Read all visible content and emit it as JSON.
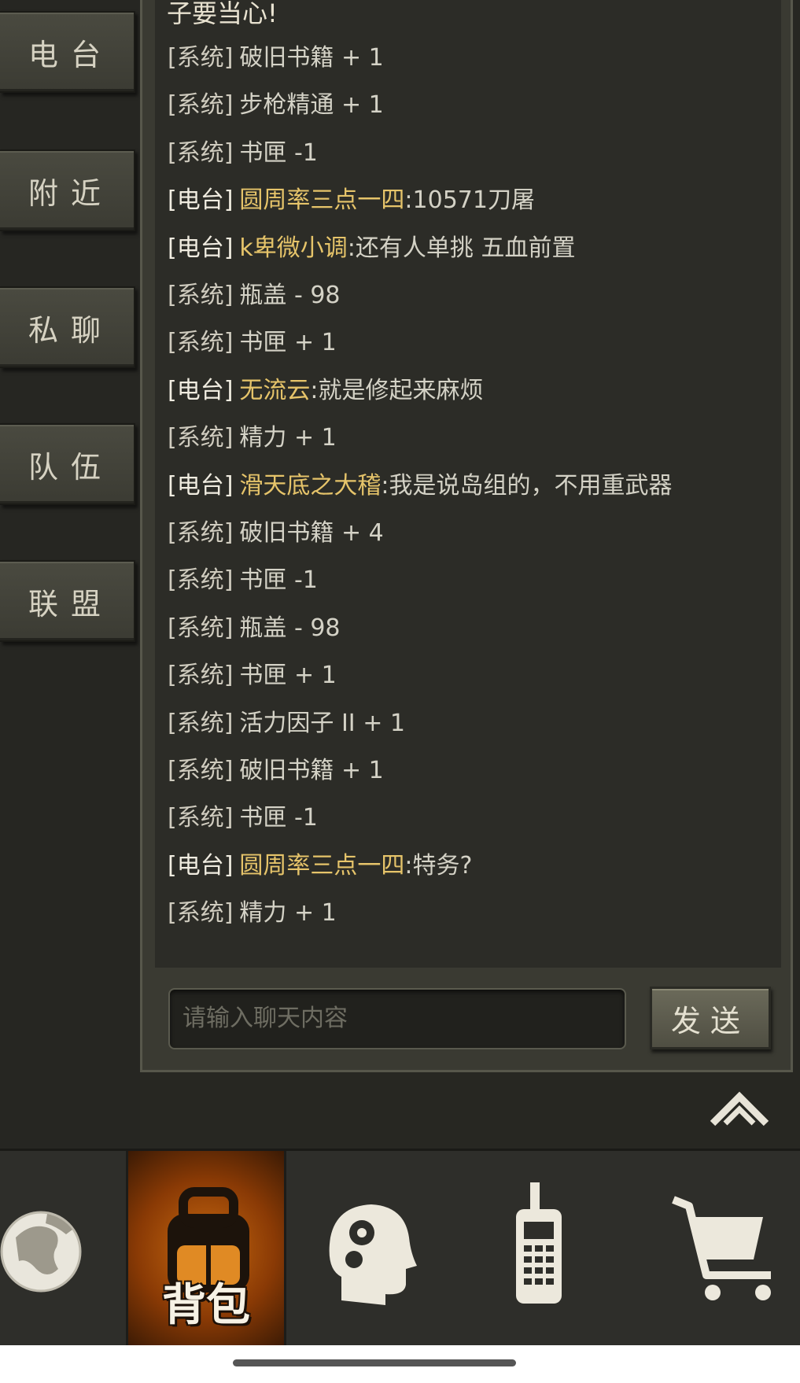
{
  "tabs": [
    {
      "label": "电台"
    },
    {
      "label": "附近"
    },
    {
      "label": "私聊"
    },
    {
      "label": "队伍"
    },
    {
      "label": "联盟"
    }
  ],
  "chat": {
    "first_line": "子要当心!",
    "messages": [
      {
        "tag": "[系统]",
        "speaker": "",
        "text": "破旧书籍 + 1"
      },
      {
        "tag": "[系统]",
        "speaker": "",
        "text": "步枪精通 + 1"
      },
      {
        "tag": "[系统]",
        "speaker": "",
        "text": "书匣 -1"
      },
      {
        "tag": "[电台]",
        "speaker": "圆周率三点一四",
        "text": ":10571刀屠"
      },
      {
        "tag": "[电台]",
        "speaker": "k卑微小调",
        "text": ":还有人单挑 五血前置"
      },
      {
        "tag": "[系统]",
        "speaker": "",
        "text": "瓶盖 - 98"
      },
      {
        "tag": "[系统]",
        "speaker": "",
        "text": "书匣 + 1"
      },
      {
        "tag": "[电台]",
        "speaker": "无流云",
        "text": ":就是修起来麻烦"
      },
      {
        "tag": "[系统]",
        "speaker": "",
        "text": "精力 + 1"
      },
      {
        "tag": "[电台]",
        "speaker": "滑天底之大稽",
        "text": ":我是说岛组的，不用重武器"
      },
      {
        "tag": "[系统]",
        "speaker": "",
        "text": "破旧书籍 + 4"
      },
      {
        "tag": "[系统]",
        "speaker": "",
        "text": "书匣 -1"
      },
      {
        "tag": "[系统]",
        "speaker": "",
        "text": "瓶盖 - 98"
      },
      {
        "tag": "[系统]",
        "speaker": "",
        "text": "书匣 + 1"
      },
      {
        "tag": "[系统]",
        "speaker": "",
        "text": "活力因子 II + 1"
      },
      {
        "tag": "[系统]",
        "speaker": "",
        "text": "破旧书籍 + 1"
      },
      {
        "tag": "[系统]",
        "speaker": "",
        "text": "书匣 -1"
      },
      {
        "tag": "[电台]",
        "speaker": "圆周率三点一四",
        "text": ":特务?"
      },
      {
        "tag": "[系统]",
        "speaker": "",
        "text": "精力 + 1"
      }
    ],
    "input_placeholder": "请输入聊天内容",
    "send_label": "发送"
  },
  "nav": {
    "items": [
      {
        "icon": "globe-icon"
      },
      {
        "icon": "backpack-icon",
        "label": "背包",
        "active": true
      },
      {
        "icon": "head-gears-icon"
      },
      {
        "icon": "walkie-talkie-icon"
      },
      {
        "icon": "shopping-cart-icon"
      }
    ]
  },
  "colors": {
    "speaker": "#e6c46a",
    "active_nav": "#c86a10"
  }
}
